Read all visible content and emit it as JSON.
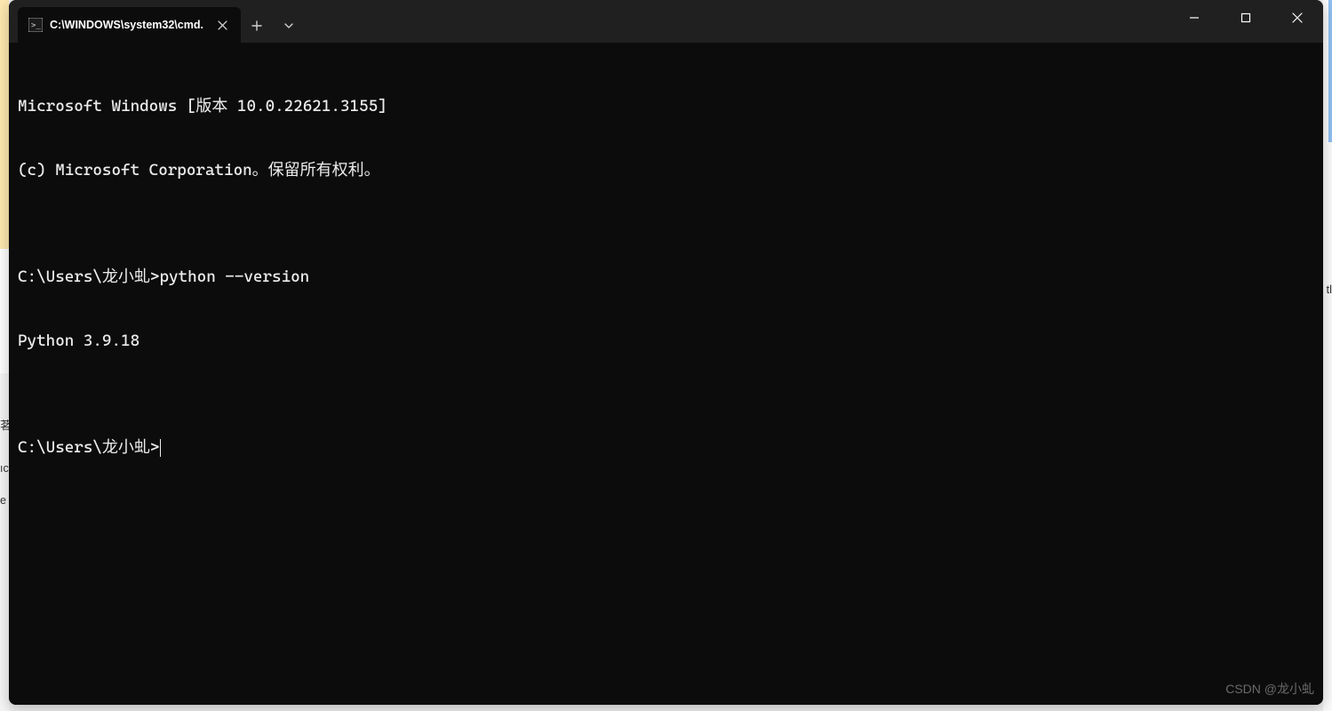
{
  "window": {
    "tab_title": "C:\\WINDOWS\\system32\\cmd."
  },
  "terminal": {
    "lines": [
      "Microsoft Windows [版本 10.0.22621.3155]",
      "(c) Microsoft Corporation。保留所有权利。",
      "",
      "C:\\Users\\龙小虬>python --version",
      "Python 3.9.18",
      "",
      "C:\\Users\\龙小虬>"
    ]
  },
  "watermark": "CSDN @龙小虬",
  "edges": {
    "right_char": "tl",
    "left_frag_1": "茗",
    "left_frag_2": "ıc",
    "left_frag_3": "e"
  }
}
